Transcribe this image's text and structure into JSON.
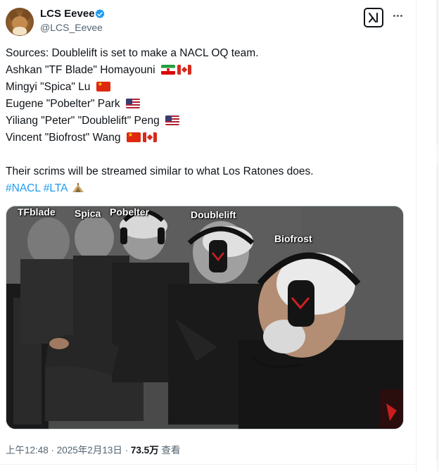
{
  "author": {
    "display_name": "LCS Eevee",
    "handle": "@LCS_Eevee",
    "verified": true,
    "avatar_icon": "eevee-avatar-icon"
  },
  "header_actions": {
    "grok_icon": "grok-icon",
    "more_icon": "more-dots-icon"
  },
  "tweet": {
    "lines": [
      {
        "text": "Sources: Doublelift is set to make a NACL OQ team.",
        "flags": []
      },
      {
        "text": "Ashkan \"TF Blade\" Homayouni",
        "flags": [
          "Iran",
          "Canada"
        ]
      },
      {
        "text": "Mingyi \"Spica\" Lu",
        "flags": [
          "China"
        ]
      },
      {
        "text": "Eugene \"Pobelter\" Park",
        "flags": [
          "United States"
        ]
      },
      {
        "text": "Yiliang \"Peter\" \"Doublelift\" Peng",
        "flags": [
          "United States"
        ]
      },
      {
        "text": "Vincent \"Biofrost\" Wang",
        "flags": [
          "China",
          "Canada"
        ]
      }
    ],
    "paragraph2": "Their scrims will be streamed similar to what Los Ratones does.",
    "hashtags": [
      "#NACL",
      "#LTA"
    ],
    "hashtag_emoji_icon": "castle-tower-icon"
  },
  "media": {
    "labels": [
      "TFblade",
      "Spica",
      "Pobelter",
      "Doublelift",
      "Biofrost"
    ]
  },
  "meta": {
    "timestamp": "上午12:48 · 2025年2月13日 · ",
    "views": "73.5万",
    "views_label": " 查看"
  },
  "colors": {
    "text": "#0f1419",
    "secondary": "#536471",
    "link": "#1d9bf0",
    "verified": "#1d9bf0"
  }
}
